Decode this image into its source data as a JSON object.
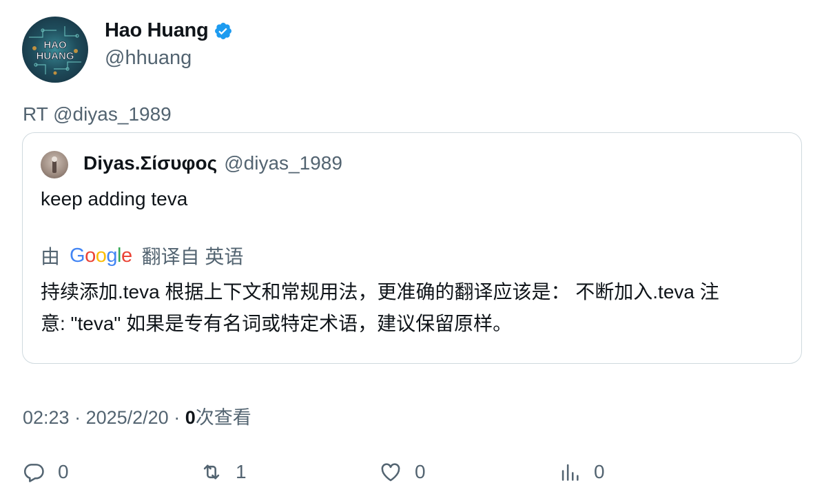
{
  "author": {
    "display_name": "Hao Huang",
    "handle": "@hhuang",
    "avatar_text_line1": "HAO",
    "avatar_text_line2": "HUANG"
  },
  "retweet_line": "RT @diyas_1989",
  "quoted": {
    "display_name": "Diyas.Σίσυφος",
    "handle": "@diyas_1989",
    "text": "keep adding teva",
    "translation": {
      "prefix": "由",
      "provider": [
        "G",
        "o",
        "o",
        "g",
        "l",
        "e"
      ],
      "provider_colors": [
        "#4285F4",
        "#EA4335",
        "#FBBC05",
        "#4285F4",
        "#34A853",
        "#EA4335"
      ],
      "suffix": "翻译自 英语",
      "text": "持续添加.teva 根据上下文和常规用法，更准确的翻译应该是： 不断加入.teva 注意: \"teva\" 如果是专有名词或特定术语，建议保留原样。"
    }
  },
  "meta": {
    "time": "02:23",
    "sep1": " · ",
    "date": "2025/2/20",
    "sep2": " · ",
    "views_count": "0",
    "views_label": "次查看"
  },
  "actions": {
    "replies": "0",
    "retweets": "1",
    "likes": "0",
    "views": "0"
  },
  "colors": {
    "verified": "#1d9bf0",
    "secondary_text": "#536471",
    "border": "#cfd9de"
  },
  "icons": [
    "verified-badge-icon",
    "reply-icon",
    "retweet-icon",
    "like-icon",
    "views-icon"
  ]
}
